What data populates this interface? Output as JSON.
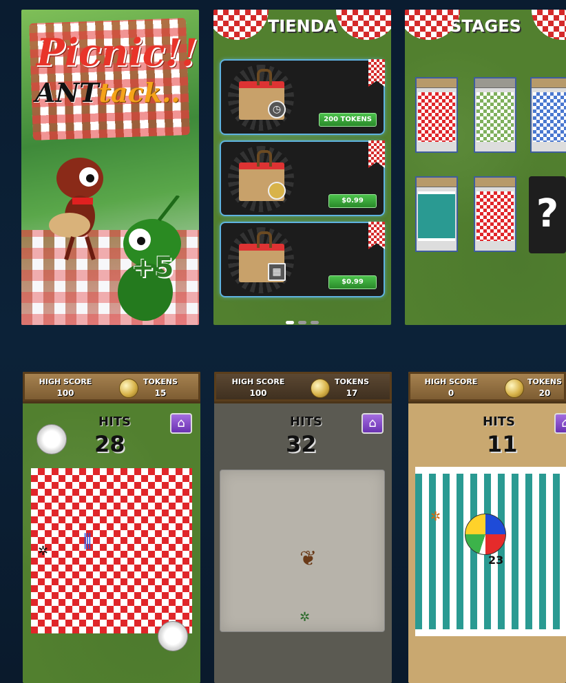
{
  "screens": {
    "title": {
      "logo_word1": "Picnic",
      "logo_bang": "!!",
      "logo_word2a": "ANT",
      "logo_word2b": "tack",
      "logo_dots": "..",
      "bonus": "+5"
    },
    "shop": {
      "title": "TIENDA",
      "items": [
        {
          "price": "200 TOKENS",
          "icon": "stopwatch-icon"
        },
        {
          "price": "$0.99",
          "icon": "coin-icon"
        },
        {
          "price": "$0.99",
          "icon": "film-icon"
        }
      ],
      "pages": 3,
      "active_page": 1
    },
    "stages": {
      "title": "STAGES",
      "locked_symbol": "?"
    },
    "games": [
      {
        "high_score_label": "HIGH SCORE",
        "high_score": "100",
        "tokens_label": "TOKENS",
        "tokens": "15",
        "hits_label": "HITS",
        "hits": "28"
      },
      {
        "high_score_label": "HIGH SCORE",
        "high_score": "100",
        "tokens_label": "TOKENS",
        "tokens": "17",
        "hits_label": "HITS",
        "hits": "32"
      },
      {
        "high_score_label": "HIGH SCORE",
        "high_score": "0",
        "tokens_label": "TOKENS",
        "tokens": "20",
        "hits_label": "HITS",
        "hits": "11",
        "ball_count": "23"
      }
    ]
  },
  "colors": {
    "background": "#0c2238",
    "grass": "#52802f",
    "checker_red": "#e0262a",
    "button_green": "#2a8a2a",
    "card_border": "#5fb3e0",
    "home_purple": "#6a32b2"
  }
}
